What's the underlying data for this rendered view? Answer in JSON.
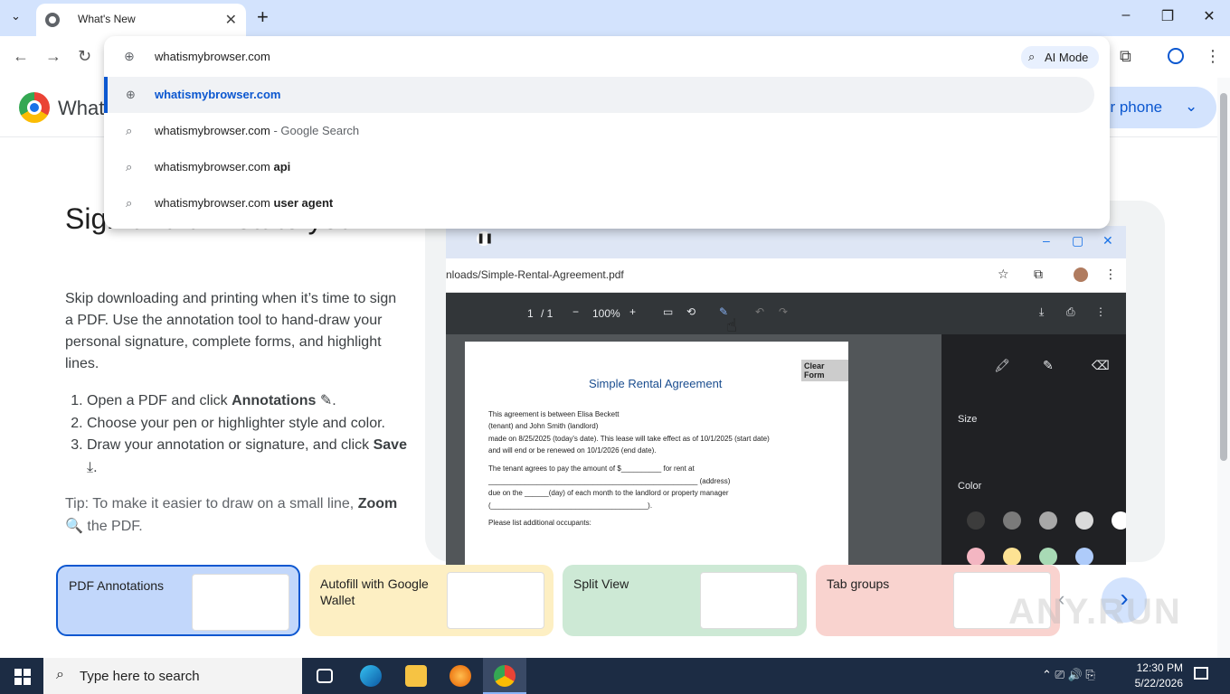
{
  "tab": {
    "title": "What's New",
    "close": "✕",
    "new_tab": "+"
  },
  "window_controls": {
    "minimize": "–",
    "maximize": "❐",
    "close": "✕"
  },
  "omnibox": {
    "input": "whatismybrowser.com",
    "ai_mode": "AI Mode",
    "suggestions": [
      {
        "text": "whatismybrowser.com",
        "suffix": "",
        "type": "url"
      },
      {
        "text": "whatismybrowser.com",
        "suffix": " - Google Search",
        "type": "search"
      },
      {
        "text": "whatismybrowser.com ",
        "suffix": "api",
        "type": "search"
      },
      {
        "text": "whatismybrowser.com ",
        "suffix": "user agent",
        "type": "search"
      }
    ]
  },
  "page": {
    "brand": "What's",
    "phone_button": "ur phone",
    "heading": "Sign and annotate your PDFs",
    "intro": "Skip downloading and printing when it’s time to sign a PDF. Use the annotation tool to hand-draw your personal signature, complete forms, and highlight lines.",
    "steps": [
      {
        "pre": "Open a PDF and click ",
        "bold": "Annotations",
        "post": " ✎."
      },
      {
        "pre": "Choose your pen or highlighter style and color.",
        "bold": "",
        "post": ""
      },
      {
        "pre": "Draw your annotation or signature, and click ",
        "bold": "Save",
        "post": " ⤓."
      }
    ],
    "tip_pre": "Tip: To make it easier to draw on a small line, ",
    "tip_bold": "Zoom",
    "tip_post": " the PDF."
  },
  "demo": {
    "url": "nloads/Simple-Rental-Agreement.pdf",
    "page_num": "1",
    "page_total": "/ 1",
    "zoom": "100%",
    "pdf_title": "Simple Rental Agreement",
    "clear_form": "Clear Form",
    "lines": [
      "This agreement is between   Elisa Beckett",
      "(tenant) and   John Smith                                                  (landlord)",
      "made on    8/25/2025   (today's date). This lease will take effect as of   10/1/2025       (start date)",
      "and will end or be renewed on   10/1/2026                 (end date).",
      "The tenant agrees to pay the amount of $__________  for rent at",
      "____________________________________________________ (address)",
      "due on the ______(day) of each month to the landlord or property manager",
      "(_______________________________________).",
      "Please list additional occupants:"
    ],
    "side_size": "Size",
    "side_color": "Color",
    "colors": [
      "#3c3c3c",
      "#7a7a7a",
      "#a8a8a8",
      "#dadada",
      "#ffffff",
      "#f4b6c2",
      "#fde293",
      "#a8dab5",
      "#aecbfa"
    ]
  },
  "cards": [
    {
      "title": "PDF Annotations",
      "bg": "#c2d7fb",
      "active": true
    },
    {
      "title": "Autofill with Google Wallet",
      "bg": "#fdefc3",
      "active": false
    },
    {
      "title": "Split View",
      "bg": "#cde9d5",
      "active": false
    },
    {
      "title": "Tab groups",
      "bg": "#f9d3cf",
      "active": false
    }
  ],
  "taskbar": {
    "search_placeholder": "Type here to search",
    "time": "12:30 PM",
    "date": "5/22/2026"
  },
  "watermark": "ANY.RUN"
}
